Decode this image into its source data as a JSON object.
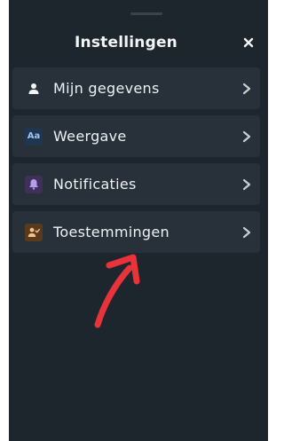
{
  "header": {
    "title": "Instellingen",
    "close_glyph": "✕"
  },
  "menu": {
    "items": [
      {
        "label": "Mijn gegevens",
        "icon": "user-icon"
      },
      {
        "label": "Weergave",
        "icon": "text-size-icon",
        "icon_text": "Aa"
      },
      {
        "label": "Notificaties",
        "icon": "bell-icon"
      },
      {
        "label": "Toestemmingen",
        "icon": "user-check-icon"
      }
    ]
  },
  "colors": {
    "background": "#1e262d",
    "item_background": "#283139",
    "text": "#eef1f3",
    "annotation_arrow": "#e8333a"
  }
}
